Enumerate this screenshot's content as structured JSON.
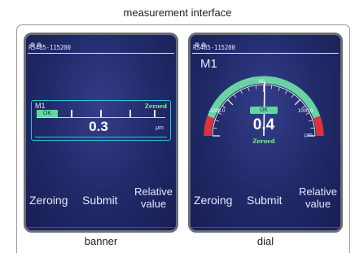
{
  "heading": "measurement interface",
  "panels": [
    {
      "caption": "banner",
      "comm": "RS485-115200",
      "name": "M1",
      "status": "Zeroed",
      "ok": "OK",
      "value": "0.3",
      "unit": "μm",
      "softkeys": [
        "Zeroing",
        "Submit",
        "Relative",
        "value"
      ]
    },
    {
      "caption": "dial",
      "comm": "RS485-115200",
      "name": "M1",
      "status": "Zeroed",
      "ok": "OK",
      "value": "0.4",
      "unit": "μm",
      "scale_left": "-1000.0",
      "scale_right": "1000.0",
      "scale_center": "00",
      "softkeys": [
        "Zeroing",
        "Submit",
        "Relative",
        "value"
      ]
    }
  ],
  "colors": {
    "screen_bg": "#222b6a",
    "banner_border": "#27c6d6",
    "ok_badge": "#5fd99c",
    "zeroed_text": "#7cf08c",
    "dial_green": "#6ad3a4",
    "dial_red": "#e0303a"
  }
}
